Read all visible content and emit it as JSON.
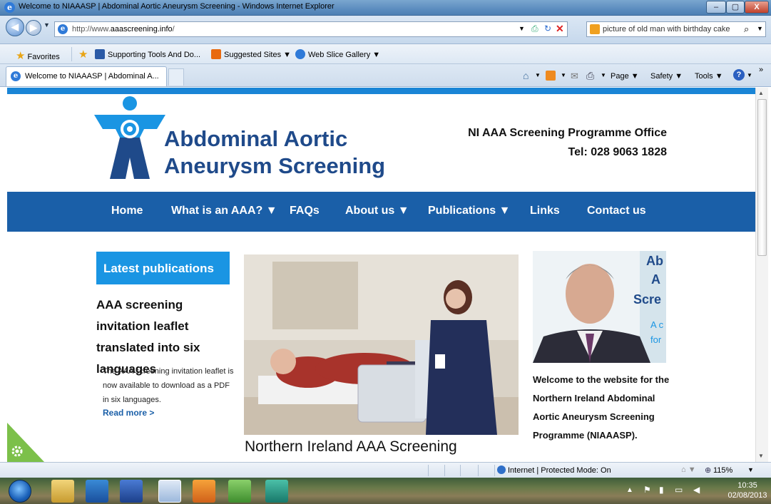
{
  "window": {
    "title": "Welcome to NIAAASP | Abdominal Aortic Aneurysm Screening - Windows Internet Explorer",
    "buttons": [
      "–",
      "▢",
      "X"
    ]
  },
  "address_bar": {
    "url_prefix": "http://www.",
    "url_domain": "aaascreening.info",
    "url_suffix": "/"
  },
  "search": {
    "text": "picture of old man with birthday cake"
  },
  "favorites_bar": {
    "favorites_label": "Favorites",
    "items": [
      "Supporting Tools And Do...",
      "Suggested Sites ▼",
      "Web Slice Gallery ▼"
    ]
  },
  "tab": {
    "label": "Welcome to NIAAASP | Abdominal A..."
  },
  "command_bar": {
    "page": "Page ▼",
    "safety": "Safety ▼",
    "tools": "Tools ▼"
  },
  "site": {
    "logo_line1": "Abdominal Aortic",
    "logo_line2": "Aneurysm Screening",
    "office": "NI AAA Screening Programme Office",
    "tel": "Tel: 028 9063 1828",
    "nav": [
      "Home",
      "What is an AAA? ▼",
      "FAQs",
      "About us ▼",
      "Publications ▼",
      "Links",
      "Contact us"
    ],
    "latest_header": "Latest publications",
    "pub_title": "AAA screening invitation leaflet translated into six languages",
    "pub_body": "The AAA screening invitation leaflet is now available to download as a PDF in six languages.",
    "read_more": "Read more >",
    "photo_caption": "Northern Ireland AAA Screening",
    "portrait_banner": [
      "Ab",
      "A",
      "Scre",
      "A c",
      "for"
    ],
    "welcome": "Welcome to the website for the Northern Ireland Abdominal Aortic Aneurysm Screening Programme (NIAAASP)."
  },
  "status_bar": {
    "zone": "Internet | Protected Mode: On",
    "zoom": "115%"
  },
  "taskbar": {
    "time": "10:35",
    "date": "02/08/2013"
  }
}
